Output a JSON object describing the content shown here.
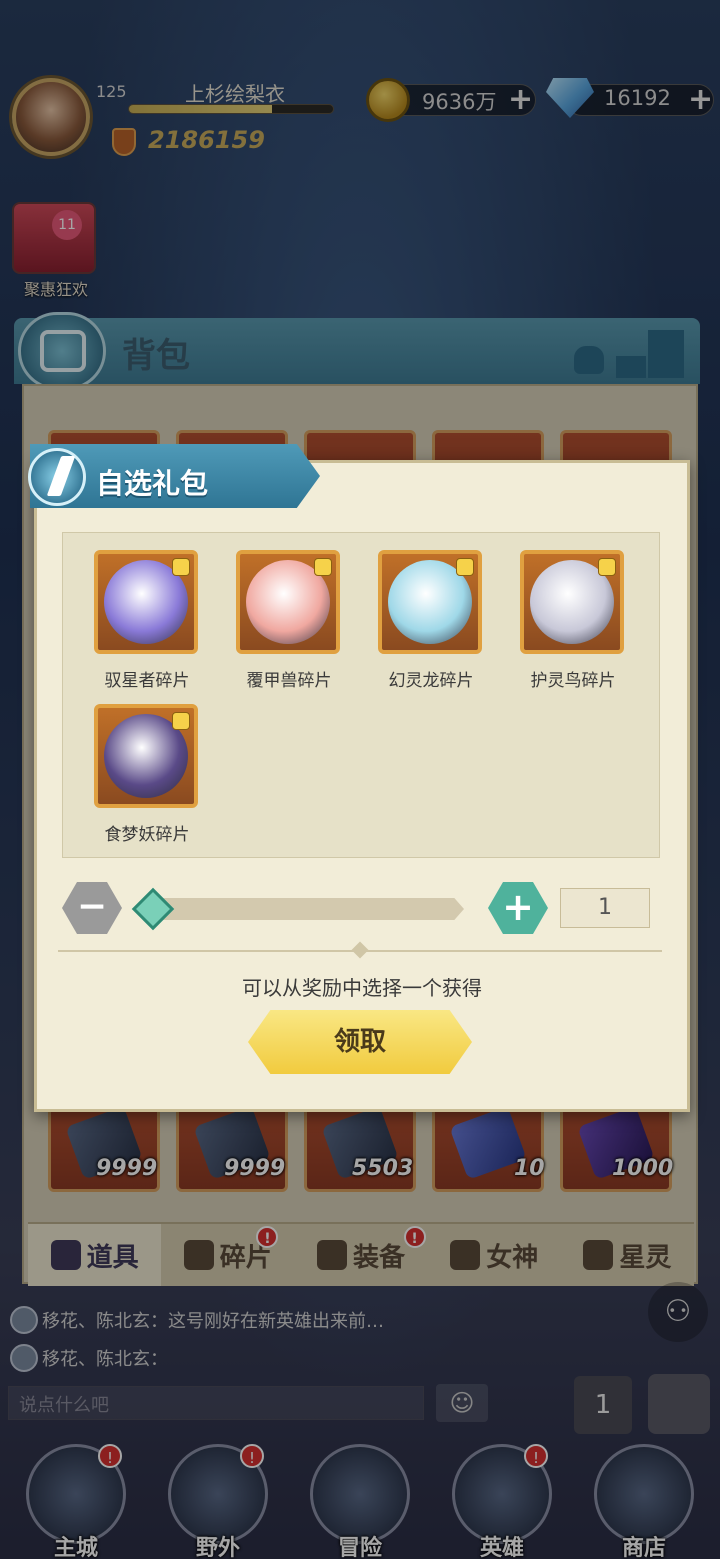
{
  "player": {
    "level": "125",
    "name": "上杉绘梨衣",
    "xp_fraction": 0.7,
    "power": "2186159"
  },
  "resources": {
    "gold": "9636万",
    "gems": "16192",
    "plus": "+"
  },
  "promo": {
    "label": "聚惠狂欢",
    "badge": "11"
  },
  "backpack": {
    "title": "背包",
    "bottom_slots": [
      {
        "count": "9999"
      },
      {
        "count": "9999"
      },
      {
        "count": "5503"
      },
      {
        "count": "10"
      },
      {
        "count": "1000"
      }
    ],
    "tabs": [
      {
        "label": "道具",
        "badge": ""
      },
      {
        "label": "碎片",
        "badge": "!"
      },
      {
        "label": "装备",
        "badge": "!"
      },
      {
        "label": "女神",
        "badge": ""
      },
      {
        "label": "星灵",
        "badge": ""
      }
    ]
  },
  "modal": {
    "title": "自选礼包",
    "rewards": [
      {
        "label": "驭星者碎片",
        "color": "#8a7ad8"
      },
      {
        "label": "覆甲兽碎片",
        "color": "#f0a8a0"
      },
      {
        "label": "幻灵龙碎片",
        "color": "#9fd8e8"
      },
      {
        "label": "护灵鸟碎片",
        "color": "#c8c8d8"
      },
      {
        "label": "食梦妖碎片",
        "color": "#5a4a88"
      }
    ],
    "quantity": "1",
    "minus": "−",
    "plus": "+",
    "slider_fraction": 0.0,
    "hint": "可以从奖励中选择一个获得",
    "claim_label": "领取"
  },
  "chat": {
    "line1": "移花、陈北玄：这号刚好在新英雄出来前…",
    "line2": "移花、陈北玄：",
    "placeholder": "说点什么吧"
  },
  "bottom_nav": [
    {
      "label": "主城",
      "badge": "!"
    },
    {
      "label": "野外",
      "badge": "!"
    },
    {
      "label": "冒险",
      "badge": ""
    },
    {
      "label": "英雄",
      "badge": "!"
    },
    {
      "label": "商店",
      "badge": ""
    }
  ],
  "colors": {
    "accent_blue": "#3f7c95",
    "claim_yellow": "#f1cb3e",
    "plus_green": "#4fb29c"
  }
}
